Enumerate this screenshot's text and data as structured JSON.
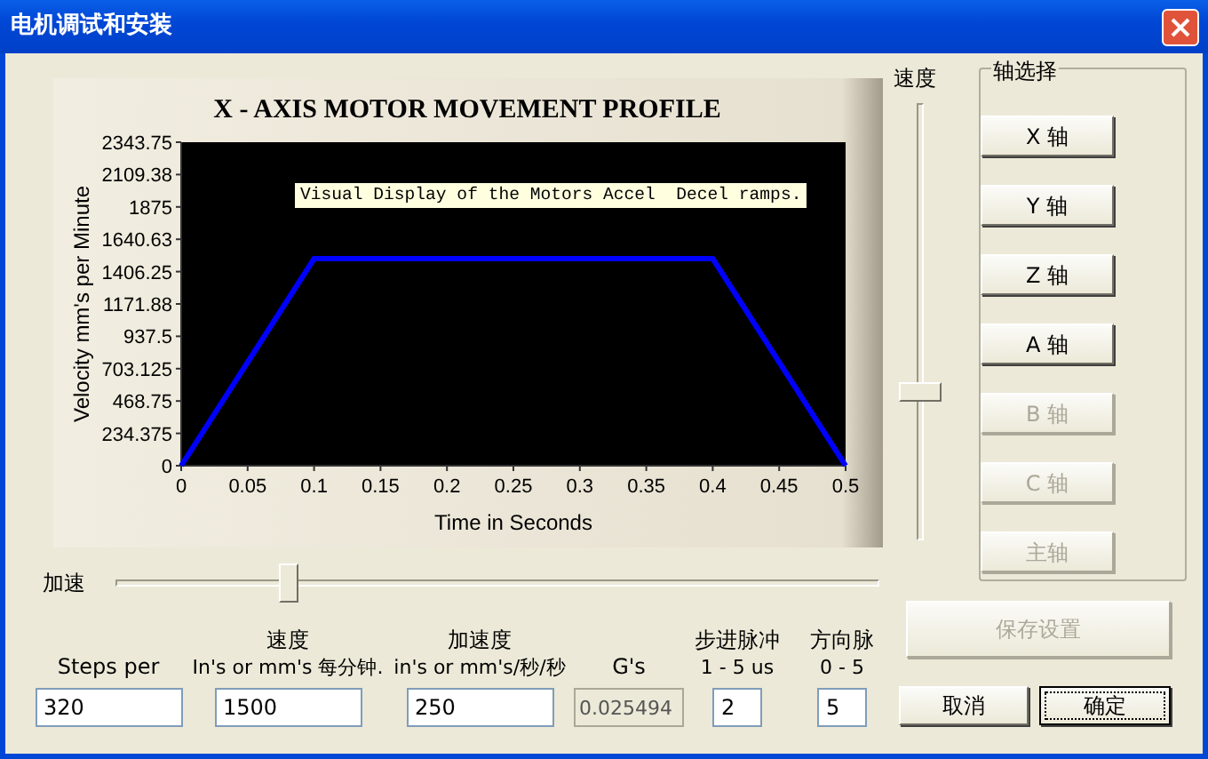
{
  "window": {
    "title": "电机调试和安装"
  },
  "chart": {
    "chart_data": {
      "type": "line",
      "title": "X - AXIS MOTOR MOVEMENT PROFILE",
      "xlabel": "Time in Seconds",
      "ylabel": "Velocity mm's per Minute",
      "x": [
        0,
        0.1,
        0.4,
        0.5
      ],
      "series": [
        {
          "color": "#0000ff",
          "values": [
            0,
            1500,
            1500,
            0
          ]
        }
      ],
      "xlim": [
        0,
        0.5
      ],
      "ylim": [
        0,
        2343.75
      ],
      "xticks": [
        0,
        0.05,
        0.1,
        0.15,
        0.2,
        0.25,
        0.3,
        0.35,
        0.4,
        0.45,
        0.5
      ],
      "yticks": [
        0,
        234.375,
        468.75,
        703.125,
        937.5,
        {
          "value": 1171.875,
          "label": "1171.88"
        },
        1406.25,
        {
          "value": 1640.625,
          "label": "1640.63"
        },
        1875,
        {
          "value": 2109.375,
          "label": "2109.38"
        },
        2343.75
      ],
      "annotations": [
        "Visual Display of the Motors Accel  Decel ramps."
      ]
    }
  },
  "speed_slider": {
    "label": "速度",
    "level": 0.33
  },
  "axis_group": {
    "title": "轴选择",
    "buttons": [
      {
        "label": "X 轴",
        "disabled": false
      },
      {
        "label": "Y 轴",
        "disabled": false
      },
      {
        "label": "Z 轴",
        "disabled": false
      },
      {
        "label": "A 轴",
        "disabled": false
      },
      {
        "label": "B 轴",
        "disabled": true
      },
      {
        "label": "C 轴",
        "disabled": true
      },
      {
        "label": "主轴",
        "disabled": true
      }
    ]
  },
  "accel_slider": {
    "label": "加速",
    "level": 0.22
  },
  "fields": [
    {
      "label": "Steps per",
      "value": "320",
      "disabled": false
    },
    {
      "label": "速度",
      "sublabel": "In's or mm's 每分钟.",
      "value": "1500",
      "disabled": false
    },
    {
      "label": "加速度",
      "sublabel": "in's or mm's/秒/秒",
      "value": "250",
      "disabled": false
    },
    {
      "label": "G's",
      "value": "0.025494",
      "disabled": true
    },
    {
      "label": "步进脉冲",
      "sublabel": "1 - 5 us",
      "value": "2",
      "disabled": false
    },
    {
      "label": "方向脉",
      "sublabel": "0 - 5",
      "value": "5",
      "disabled": false
    }
  ],
  "actions": [
    {
      "label": "保存设置",
      "disabled": true,
      "focused": false
    },
    {
      "label": "取消",
      "disabled": false,
      "focused": false
    },
    {
      "label": "确定",
      "disabled": false,
      "focused": true
    }
  ]
}
